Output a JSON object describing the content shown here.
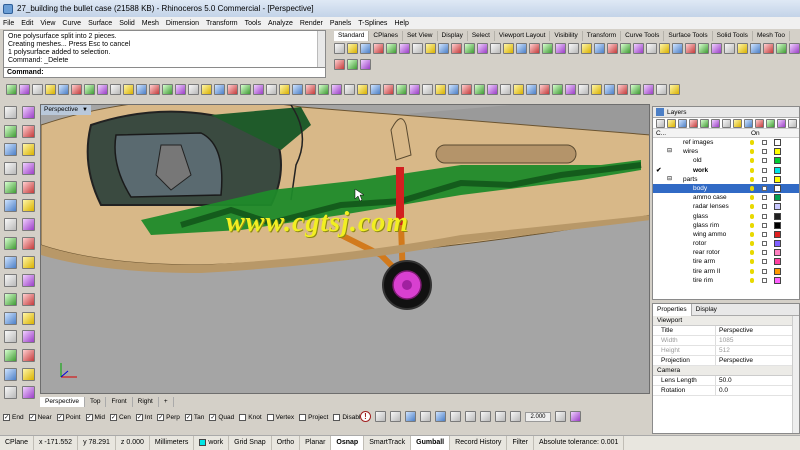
{
  "window": {
    "title": "27_building the bullet case (21588 KB) - Rhinoceros 5.0 Commercial - [Perspective]"
  },
  "menu": [
    "File",
    "Edit",
    "View",
    "Curve",
    "Surface",
    "Solid",
    "Mesh",
    "Dimension",
    "Transform",
    "Tools",
    "Analyze",
    "Render",
    "Panels",
    "T-Splines",
    "Help"
  ],
  "command_history": [
    "One polysurface split into 2 pieces.",
    "Creating meshes... Press Esc to cancel",
    "1 polysurface added to selection.",
    "Command: _Delete"
  ],
  "command_prompt": {
    "label": "Command:",
    "value": ""
  },
  "toolbar_tabs": [
    "Standard",
    "CPlanes",
    "Set View",
    "Display",
    "Select",
    "Viewport Layout",
    "Visibility",
    "Transform",
    "Curve Tools",
    "Surface Tools",
    "Solid Tools",
    "Mesh Too"
  ],
  "viewport": {
    "name": "Perspective",
    "watermark": "www.cgtsj.com"
  },
  "viewport_tabs": [
    "Perspective",
    "Top",
    "Front",
    "Right",
    "+"
  ],
  "osnaps": [
    {
      "label": "End",
      "checked": true
    },
    {
      "label": "Near",
      "checked": true
    },
    {
      "label": "Point",
      "checked": true
    },
    {
      "label": "Mid",
      "checked": true
    },
    {
      "label": "Cen",
      "checked": true
    },
    {
      "label": "Int",
      "checked": true
    },
    {
      "label": "Perp",
      "checked": true
    },
    {
      "label": "Tan",
      "checked": true
    },
    {
      "label": "Quad",
      "checked": true
    },
    {
      "label": "Knot",
      "checked": false
    },
    {
      "label": "Vertex",
      "checked": false
    },
    {
      "label": "Project",
      "checked": false
    },
    {
      "label": "Disable",
      "checked": false
    }
  ],
  "bottom_numeric": "2.000",
  "layers_panel": {
    "tab": "Layers",
    "columns": {
      "name": "C...",
      "on": "On",
      "material": ""
    },
    "rows": [
      {
        "name": "ref images",
        "indent": 1,
        "color": "#ffffff",
        "selected": false,
        "current": false,
        "expander": ""
      },
      {
        "name": "wires",
        "indent": 1,
        "color": "#ffff00",
        "selected": false,
        "current": false,
        "expander": "⊟"
      },
      {
        "name": "old",
        "indent": 2,
        "color": "#00cc33",
        "selected": false,
        "current": false,
        "expander": ""
      },
      {
        "name": "work",
        "indent": 2,
        "color": "#00e5e5",
        "selected": false,
        "current": true,
        "expander": ""
      },
      {
        "name": "parts",
        "indent": 1,
        "color": "#ffff00",
        "selected": false,
        "current": false,
        "expander": "⊟"
      },
      {
        "name": "body",
        "indent": 2,
        "color": "#ffffff",
        "selected": true,
        "current": false,
        "expander": ""
      },
      {
        "name": "ammo case",
        "indent": 2,
        "color": "#00a050",
        "selected": false,
        "current": false,
        "expander": ""
      },
      {
        "name": "radar lenses",
        "indent": 2,
        "color": "#c8c8ff",
        "selected": false,
        "current": false,
        "expander": ""
      },
      {
        "name": "glass",
        "indent": 2,
        "color": "#202020",
        "selected": false,
        "current": false,
        "expander": ""
      },
      {
        "name": "glass rim",
        "indent": 2,
        "color": "#000000",
        "selected": false,
        "current": false,
        "expander": ""
      },
      {
        "name": "wing ammo",
        "indent": 2,
        "color": "#e02020",
        "selected": false,
        "current": false,
        "expander": ""
      },
      {
        "name": "rotor",
        "indent": 2,
        "color": "#8060ff",
        "selected": false,
        "current": false,
        "expander": ""
      },
      {
        "name": "rear rotor",
        "indent": 2,
        "color": "#ff80c0",
        "selected": false,
        "current": false,
        "expander": ""
      },
      {
        "name": "tire arm",
        "indent": 2,
        "color": "#ff40a0",
        "selected": false,
        "current": false,
        "expander": ""
      },
      {
        "name": "tire arm II",
        "indent": 2,
        "color": "#ff9900",
        "selected": false,
        "current": false,
        "expander": ""
      },
      {
        "name": "tire rim",
        "indent": 2,
        "color": "#ff60ff",
        "selected": false,
        "current": false,
        "expander": ""
      }
    ]
  },
  "properties_panel": {
    "tabs": [
      "Properties",
      "Display"
    ],
    "section_viewport": "Viewport",
    "rows": [
      {
        "key": "Title",
        "value": "Perspective",
        "disabled": false,
        "drop": false
      },
      {
        "key": "Width",
        "value": "1085",
        "disabled": true,
        "drop": false
      },
      {
        "key": "Height",
        "value": "512",
        "disabled": true,
        "drop": false
      },
      {
        "key": "Projection",
        "value": "Perspective",
        "disabled": false,
        "drop": true
      }
    ],
    "section_camera": "Camera",
    "camera_rows": [
      {
        "key": "Lens Length",
        "value": "50.0"
      },
      {
        "key": "Rotation",
        "value": "0.0"
      }
    ]
  },
  "status_bar": {
    "cplane": "CPlane",
    "x": "x -171.552",
    "y": "y 78.291",
    "z": "z 0.000",
    "units": "Millimeters",
    "layer": "work",
    "layer_color": "#00e5e5",
    "toggles": [
      {
        "label": "Grid Snap",
        "on": false
      },
      {
        "label": "Ortho",
        "on": false
      },
      {
        "label": "Planar",
        "on": false
      },
      {
        "label": "Osnap",
        "on": true
      },
      {
        "label": "SmartTrack",
        "on": false
      },
      {
        "label": "Gumball",
        "on": true
      },
      {
        "label": "Record History",
        "on": false
      },
      {
        "label": "Filter",
        "on": false
      }
    ],
    "tolerance": "Absolute tolerance: 0.001"
  },
  "colors": {
    "aircraft_body": "#d8b888",
    "camo_green": "#1f8a2a",
    "dark_green_panel": "#1f5b2a",
    "gear_strut": "#d27a1c",
    "wheel_hub": "#d840d0",
    "viewport_bg": "#a5a5a5"
  }
}
